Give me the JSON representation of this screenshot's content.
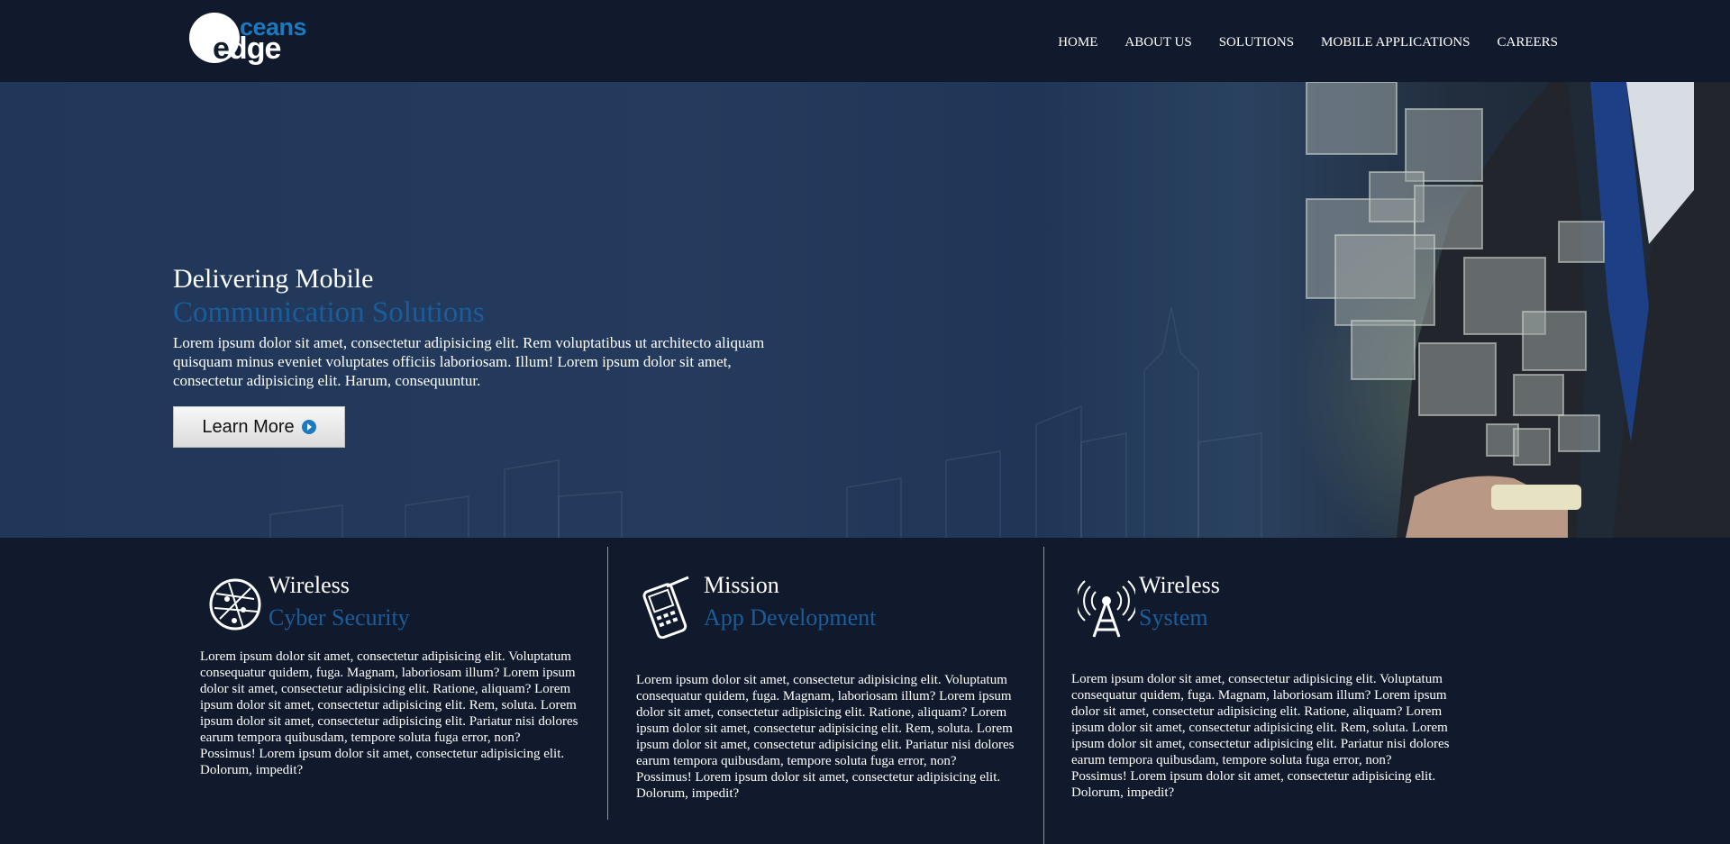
{
  "brand": {
    "logo_top": "ceans",
    "logo_bottom_e": "e",
    "logo_bottom_rest": "dge"
  },
  "nav": [
    {
      "label": "HOME"
    },
    {
      "label": "ABOUT US"
    },
    {
      "label": "SOLUTIONS"
    },
    {
      "label": "MOBILE APPLICATIONS"
    },
    {
      "label": "CAREERS"
    }
  ],
  "hero": {
    "title_line1": "Delivering Mobile",
    "title_line2": "Communication Solutions",
    "description": "Lorem ipsum dolor sit amet, consectetur adipisicing elit. Rem voluptatibus ut architecto aliquam quisquam minus eveniet voluptates officiis laboriosam. Illum! Lorem ipsum dolor sit amet, consectetur adipisicing elit. Harum, consequuntur.",
    "button_label": "Learn More"
  },
  "features": [
    {
      "icon": "globe-network-icon",
      "title_line1": "Wireless",
      "title_line2": "Cyber Security",
      "description": "Lorem ipsum dolor sit amet, consectetur adipisicing elit. Voluptatum consequatur quidem, fuga. Magnam, laboriosam illum? Lorem ipsum dolor sit amet, consectetur adipisicing elit. Ratione, aliquam? Lorem ipsum dolor sit amet, consectetur adipisicing elit. Rem, soluta. Lorem ipsum dolor sit amet, consectetur adipisicing elit. Pariatur nisi dolores earum tempora quibusdam, tempore soluta fuga error, non? Possimus! Lorem ipsum dolor sit amet, consectetur adipisicing elit. Dolorum, impedit?"
    },
    {
      "icon": "mobile-phone-icon",
      "title_line1": "Mission",
      "title_line2": "App Development",
      "description": "Lorem ipsum dolor sit amet, consectetur adipisicing elit. Voluptatum consequatur quidem, fuga. Magnam, laboriosam illum? Lorem ipsum dolor sit amet, consectetur adipisicing elit. Ratione, aliquam? Lorem ipsum dolor sit amet, consectetur adipisicing elit. Rem, soluta. Lorem ipsum dolor sit amet, consectetur adipisicing elit. Pariatur nisi dolores earum tempora quibusdam, tempore soluta fuga error, non? Possimus! Lorem ipsum dolor sit amet, consectetur adipisicing elit. Dolorum, impedit?"
    },
    {
      "icon": "radio-tower-icon",
      "title_line1": "Wireless",
      "title_line2": "System",
      "description": "Lorem ipsum dolor sit amet, consectetur adipisicing elit. Voluptatum consequatur quidem, fuga. Magnam, laboriosam illum? Lorem ipsum dolor sit amet, consectetur adipisicing elit. Ratione, aliquam? Lorem ipsum dolor sit amet, consectetur adipisicing elit. Rem, soluta. Lorem ipsum dolor sit amet, consectetur adipisicing elit. Pariatur nisi dolores earum tempora quibusdam, tempore soluta fuga error, non? Possimus! Lorem ipsum dolor sit amet, consectetur adipisicing elit. Dolorum, impedit?"
    }
  ],
  "colors": {
    "background": "#101a2c",
    "accent": "#1a5d9a",
    "logo_blue": "#1c79c0"
  }
}
